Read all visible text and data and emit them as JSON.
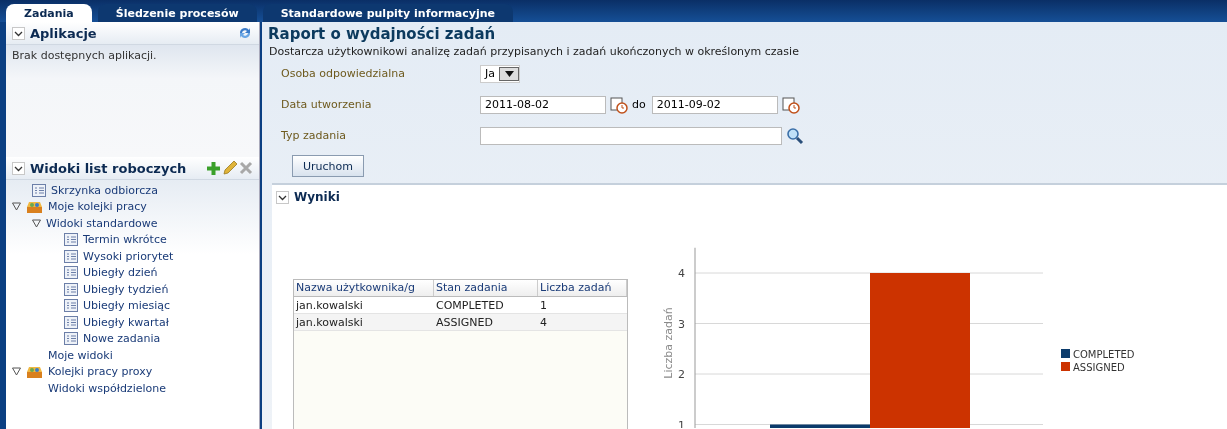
{
  "tabs": [
    {
      "label": "Zadania",
      "selected": true
    },
    {
      "label": "Śledzenie procesów",
      "selected": false
    },
    {
      "label": "Standardowe pulpity informacyjne",
      "selected": false
    }
  ],
  "applications": {
    "title": "Aplikacje",
    "expanded": true,
    "empty_text": "Brak dostępnych aplikacji."
  },
  "worklist_views": {
    "title": "Widoki list roboczych",
    "expanded": true,
    "tree": [
      {
        "label": "Skrzynka odbiorcza",
        "kind": "list"
      },
      {
        "label": "Moje kolejki pracy",
        "kind": "queue",
        "expanded": true,
        "children": [
          {
            "label": "Widoki standardowe",
            "kind": "folder",
            "expanded": true,
            "children": [
              {
                "label": "Termin wkrótce",
                "kind": "list"
              },
              {
                "label": "Wysoki priorytet",
                "kind": "list"
              },
              {
                "label": "Ubiegły dzień",
                "kind": "list"
              },
              {
                "label": "Ubiegły tydzień",
                "kind": "list"
              },
              {
                "label": "Ubiegły miesiąc",
                "kind": "list"
              },
              {
                "label": "Ubiegły kwartał",
                "kind": "list"
              },
              {
                "label": "Nowe zadania",
                "kind": "list"
              }
            ]
          },
          {
            "label": "Moje widoki",
            "kind": "plain"
          }
        ]
      },
      {
        "label": "Kolejki pracy proxy",
        "kind": "queue",
        "expanded": true,
        "children": [
          {
            "label": "Widoki współdzielone",
            "kind": "plain"
          }
        ]
      }
    ]
  },
  "report": {
    "title": "Raport o wydajności zadań",
    "description": "Dostarcza użytkownikowi analizę zadań przypisanych i zadań ukończonych w określonym czasie",
    "assignee": {
      "label": "Osoba odpowiedzialna",
      "value": "Ja"
    },
    "created": {
      "label": "Data utworzenia",
      "from": "2011-08-02",
      "separator": "do",
      "to": "2011-09-02"
    },
    "task_type": {
      "label": "Typ zadania"
    },
    "run_button": "Uruchom"
  },
  "results": {
    "title": "Wyniki",
    "expanded": true,
    "table": {
      "columns": [
        "Nazwa użytkownika/g",
        "Stan zadania",
        "Liczba zadań"
      ],
      "rows": [
        [
          "jan.kowalski",
          "COMPLETED",
          "1"
        ],
        [
          "jan.kowalski",
          "ASSIGNED",
          "4"
        ]
      ]
    },
    "chart_data": {
      "type": "bar",
      "ylabel": "Liczba zadań",
      "categories": [
        null
      ],
      "grid": true,
      "legend": "right",
      "series": [
        {
          "name": "COMPLETED",
          "color": "#0b3b6b",
          "values": [
            1
          ]
        },
        {
          "name": "ASSIGNED",
          "color": "#cc3300",
          "values": [
            4
          ]
        }
      ],
      "ylim": [
        0,
        4.5
      ],
      "yticks": [
        1,
        2,
        3,
        4
      ]
    }
  }
}
